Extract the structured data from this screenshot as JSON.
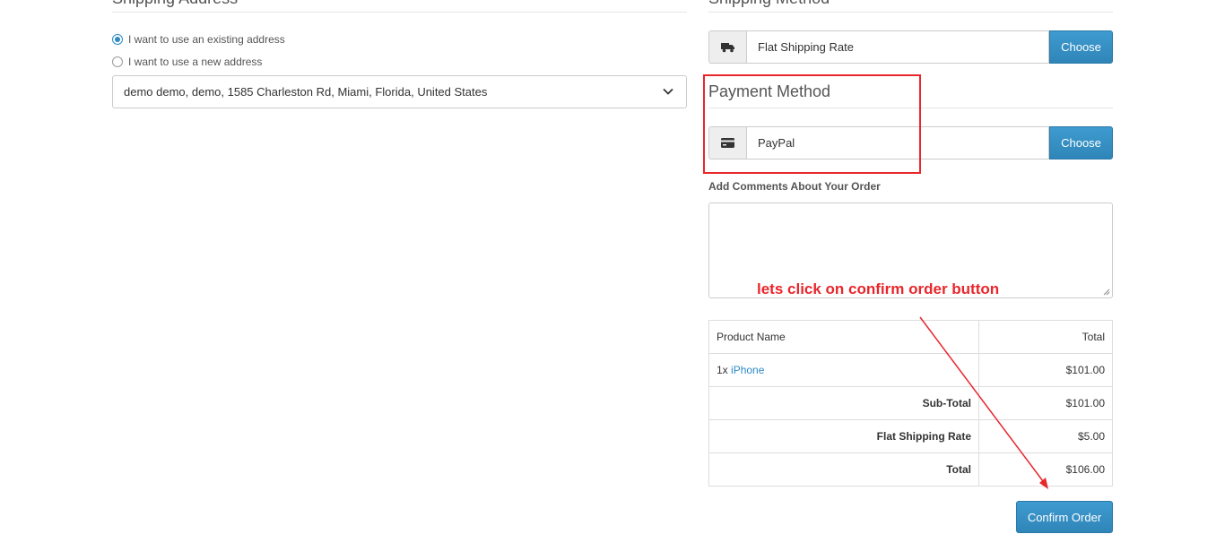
{
  "shipping_address": {
    "legend": "Shipping Address",
    "radio_existing": "I want to use an existing address",
    "radio_new": "I want to use a new address",
    "selected_address": "demo demo, demo, 1585 Charleston Rd, Miami, Florida, United States"
  },
  "shipping_method": {
    "legend": "Shipping Method",
    "value": "Flat Shipping Rate",
    "button": "Choose",
    "icon": "truck-icon"
  },
  "payment_method": {
    "legend": "Payment Method",
    "value": "PayPal",
    "button": "Choose",
    "icon": "credit-card-icon"
  },
  "comments": {
    "label": "Add Comments About Your Order",
    "value": ""
  },
  "order_table": {
    "header": {
      "product": "Product Name",
      "total": "Total"
    },
    "item": {
      "qty": "1x",
      "name": "iPhone",
      "total": "$101.00"
    },
    "subtotal": {
      "label": "Sub-Total",
      "value": "$101.00"
    },
    "shipping": {
      "label": "Flat Shipping Rate",
      "value": "$5.00"
    },
    "total": {
      "label": "Total",
      "value": "$106.00"
    }
  },
  "confirm_button": "Confirm Order",
  "annotation": {
    "text": "lets click on confirm order button",
    "color": "#e8262b"
  },
  "colors": {
    "accent": "#2d8ac7",
    "button": "#3393c5"
  }
}
